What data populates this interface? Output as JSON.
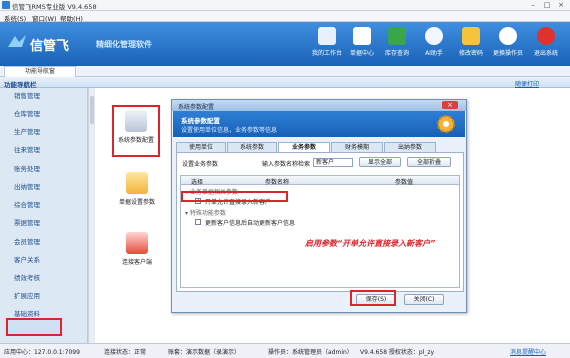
{
  "app": {
    "title": "信管飞RMS专业版 V9.4.658"
  },
  "menu": [
    "系统(S)",
    "窗口(W)",
    "帮助(H)"
  ],
  "brand": {
    "logo": "信管飞",
    "slogan": "精细化管理软件"
  },
  "toolbar": [
    {
      "label": "我的工作台",
      "icon": "monitor-icon",
      "color": "#e8f2ff"
    },
    {
      "label": "单据中心",
      "icon": "documents-icon",
      "color": "#ffffff"
    },
    {
      "label": "库存查询",
      "icon": "inventory-icon",
      "color": "#3aa64a"
    },
    {
      "label": "AI助手",
      "icon": "help-icon",
      "color": "#f4f6ff"
    },
    {
      "label": "修改密码",
      "icon": "password-icon",
      "color": "#f6c33c"
    },
    {
      "label": "更换操作员",
      "icon": "user-switch-icon",
      "color": "#ffffff"
    },
    {
      "label": "退出系统",
      "icon": "exit-icon",
      "color": "#e0322c"
    }
  ],
  "navpanel": {
    "tab": "功能导航窗",
    "header": "功能导航栏",
    "link": "随便打印"
  },
  "nav_items": [
    "销售管理",
    "仓库管理",
    "生产管理",
    "往来管理",
    "账务处理",
    "出纳管理",
    "综合管理",
    "票据管理",
    "会员管理",
    "客户关系",
    "绩效考核",
    "扩展应用",
    "基础资料",
    "系统管理"
  ],
  "main_items": [
    "系统参数配置",
    "单据设置参数",
    "连接客户端"
  ],
  "dialog": {
    "title": "系统参数配置",
    "head_title": "系统参数配置",
    "head_sub": "设置使用单位信息，业务参数等信息",
    "tabs": [
      "使用单位",
      "系统参数",
      "业务参数",
      "财务模期",
      "出纳参数"
    ],
    "setting_label": "设置业务参数",
    "search_label": "输入参数名称检索",
    "search_value": "新客户",
    "show_all": "显示全部",
    "collapse_all": "全部折叠",
    "cols": [
      "选择",
      "参数名称",
      "参数值"
    ],
    "group1": "业务单据相关参数",
    "row1": "开单允许直接录入新客户",
    "group2": "特殊功能参数",
    "row2": "更新客户信息后自动更新客户信息",
    "ok": "保存(S)",
    "cancel": "关闭(C)"
  },
  "annotation": "启用参数“开单允许直接录入新客户”",
  "status": {
    "server": "应用中心：127.0.0.1:7099",
    "conn": "连接状态：正常",
    "user": "账套：演示数据（录演示）",
    "operator": "操作员：系统管理员（admin）",
    "version": "V9.4.658 授权状态：pl_zy",
    "note": "消息提醒中心"
  }
}
